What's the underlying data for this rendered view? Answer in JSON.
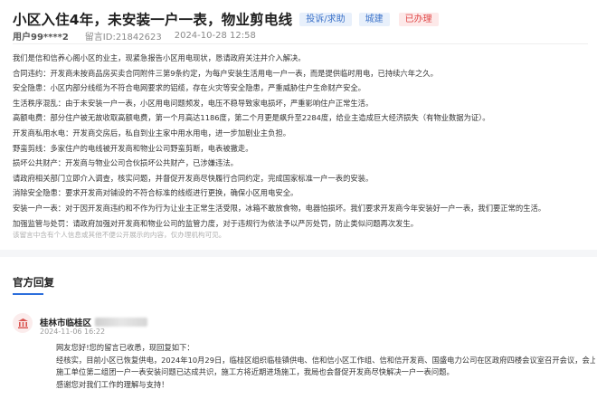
{
  "header": {
    "title": "小区入住4年，未安装一户一表，物业剪电线",
    "tags": [
      {
        "label": "投诉/求助",
        "color": "#3d73c9"
      },
      {
        "label": "城建",
        "color": "#3d73c9"
      },
      {
        "label": "已办理",
        "color": "#e04848"
      }
    ]
  },
  "meta": {
    "user": "用户99****2",
    "message_id": "留言ID:21842623",
    "datetime": "2024-10-28 12:58"
  },
  "content_lines": [
    "我们是信和信养心阁小区的业主，现紧急报告小区用电现状，恳请政府关注并介入解决。",
    "合同违约：开发商未按商品房买卖合同附件三第9条约定，为每户安装生活用电一户一表，而是提供临时用电，已持续六年之久。",
    "安全隐患：小区内部分线缆为不符合电网要求的铝缆，存在火灾等安全隐患，严重威胁住户生命财产安全。",
    "生活秩序混乱：由于未安装一户一表，小区用电问题频发，电压不稳导致家电损坏，严重影响住户正常生活。",
    "高额电费：部分住户被无故收取高额电费，第一个月高达1186度，第二个月更是飙升至2284度，给业主造成巨大经济损失（有物业数据为证）。",
    "开发商私用水电：开发商交房后，私自到业主家中用水用电，进一步加剧业主负担。",
    "野蛮剪线：多家住户的电线被开发商和物业公司野蛮剪断，电表被撤走。",
    "损坏公共财产：开发商与物业公司合伙损坏公共财产，已涉嫌违法。",
    "请政府相关部门立即介入调查，核实问题，并督促开发商尽快履行合同约定，完成国家标准一户一表的安装。",
    "消除安全隐患：要求开发商对铺设的不符合标准的线缆进行更换，确保小区用电安全。",
    "安装一户一表：对于因开发商违约和不作为行为让业主正常生活受限，冰箱不敢放食物，电器怕损坏。我们要求开发商今年安装好一户一表，我们要正常的生活。",
    "加强监管与处罚：请政府加强对开发商和物业公司的监管力度，对于违规行为依法予以严厉处罚，防止类似问题再次发生。"
  ],
  "privacy_note": "该留言中含有个人信息或其他不便公开展示的内容，仅办理机构可见。",
  "official_reply": {
    "section_title": "官方回复",
    "org_name": "桂林市临桂区",
    "date": "2024-11-06 16:22",
    "lines": [
      "网友您好!您的留言已收悉，现回复如下：",
      "经核实，目前小区已恢复供电，2024年10月29日，临桂区组织临桂镇供电、信和信小区工作组、信和信开发商、国盛电力公司在区政府四楼会议室召开会议，会上开发商与",
      "施工单位第二组团一户一表安装问题已达成共识，施工方将近期进场施工，我局也会督促开发商尽快解决一户一表问题。",
      "感谢您对我们工作的理解与支持！"
    ]
  }
}
